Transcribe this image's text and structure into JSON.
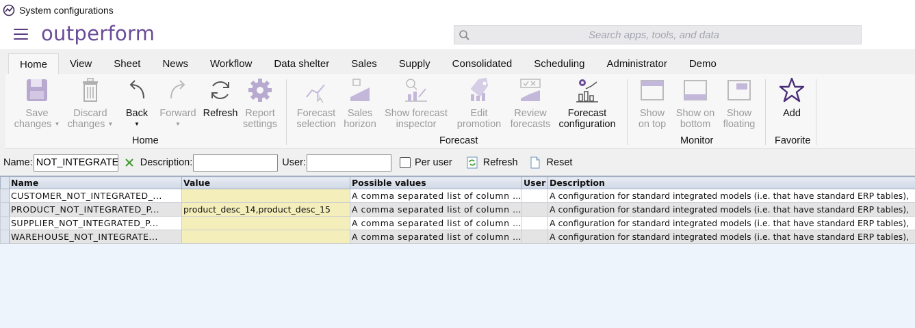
{
  "window": {
    "title": "System configurations",
    "app_icon": "outperform-logo-icon"
  },
  "brand": {
    "name": "outperform",
    "menu_icon": "hamburger-menu-icon"
  },
  "search": {
    "placeholder": "Search apps, tools, and data",
    "icon": "search-icon"
  },
  "tabs": [
    {
      "label": "Home",
      "active": true
    },
    {
      "label": "View"
    },
    {
      "label": "Sheet"
    },
    {
      "label": "News"
    },
    {
      "label": "Workflow"
    },
    {
      "label": "Data shelter"
    },
    {
      "label": "Sales"
    },
    {
      "label": "Supply"
    },
    {
      "label": "Consolidated"
    },
    {
      "label": "Scheduling"
    },
    {
      "label": "Administrator"
    },
    {
      "label": "Demo"
    }
  ],
  "ribbon": {
    "home": {
      "group_label": "Home",
      "save": {
        "line1": "Save",
        "line2": "changes",
        "enabled": false
      },
      "discard": {
        "line1": "Discard",
        "line2": "changes",
        "enabled": false
      },
      "back": {
        "line1": "Back",
        "enabled": true
      },
      "forward": {
        "line1": "Forward",
        "enabled": false
      },
      "refresh": {
        "line1": "Refresh",
        "enabled": true
      },
      "report": {
        "line1": "Report",
        "line2": "settings",
        "enabled": false
      }
    },
    "forecast": {
      "group_label": "Forecast",
      "selection": {
        "line1": "Forecast",
        "line2": "selection",
        "enabled": false
      },
      "sales_horizon": {
        "line1": "Sales",
        "line2": "horizon",
        "enabled": false
      },
      "inspector": {
        "line1": "Show forecast",
        "line2": "inspector",
        "enabled": false
      },
      "edit_promotion": {
        "line1": "Edit",
        "line2": "promotion",
        "enabled": false
      },
      "review": {
        "line1": "Review",
        "line2": "forecasts",
        "enabled": false
      },
      "configuration": {
        "line1": "Forecast",
        "line2": "configuration",
        "enabled": true
      }
    },
    "monitor": {
      "group_label": "Monitor",
      "on_top": {
        "line1": "Show",
        "line2": "on top",
        "enabled": false
      },
      "on_bottom": {
        "line1": "Show on",
        "line2": "bottom",
        "enabled": false
      },
      "floating": {
        "line1": "Show",
        "line2": "floating",
        "enabled": false
      }
    },
    "favorite": {
      "group_label": "Favorite",
      "add": {
        "line1": "Add",
        "enabled": true
      }
    }
  },
  "filter": {
    "name_label": "Name:",
    "name_value": "NOT_INTEGRATED",
    "description_label": "Description:",
    "description_value": "",
    "user_label": "User:",
    "user_value": "",
    "per_user_label": "Per user",
    "per_user_checked": false,
    "refresh_label": "Refresh",
    "reset_label": "Reset"
  },
  "table": {
    "columns": [
      "Name",
      "Value",
      "Possible values",
      "User",
      "Description"
    ],
    "rows": [
      {
        "name": "CUSTOMER_NOT_INTEGRATED_...",
        "value": "",
        "possible": "A comma separated list of column n...",
        "user": "",
        "description": "A configuration for standard integrated models (i.e. that have standard ERP tables),"
      },
      {
        "name": "PRODUCT_NOT_INTEGRATED_P...",
        "value": "product_desc_14,product_desc_15",
        "possible": "A comma separated list of column n...",
        "user": "",
        "description": "A configuration for standard integrated models (i.e. that have standard ERP tables),"
      },
      {
        "name": "SUPPLIER_NOT_INTEGRATED_P...",
        "value": "",
        "possible": "A comma separated list of column n...",
        "user": "",
        "description": "A configuration for standard integrated models (i.e. that have standard ERP tables),"
      },
      {
        "name": "WAREHOUSE_NOT_INTEGRATE...",
        "value": "",
        "possible": "A comma separated list of column n...",
        "user": "",
        "description": "A configuration for standard integrated models (i.e. that have standard ERP tables),"
      }
    ]
  },
  "colors": {
    "brand": "#6b4c98",
    "value_cell": "#f4eebb",
    "grid_bg": "#eef4fb"
  }
}
